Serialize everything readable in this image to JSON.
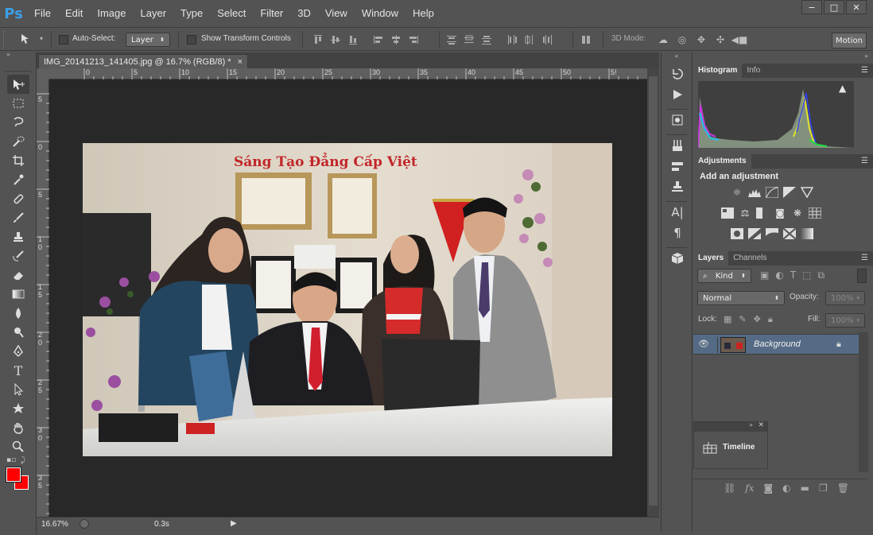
{
  "app": {
    "logo": "Ps",
    "menu": [
      "File",
      "Edit",
      "Image",
      "Layer",
      "Type",
      "Select",
      "Filter",
      "3D",
      "View",
      "Window",
      "Help"
    ],
    "window_controls": [
      "−",
      "□",
      "✕"
    ]
  },
  "options": {
    "auto_select_label": "Auto-Select:",
    "auto_select_value": "Layer",
    "show_transform_label": "Show Transform Controls",
    "mode_3d_label": "3D Mode:",
    "workspace_button": "Motion"
  },
  "document": {
    "tab_title": "IMG_20141213_141405.jpg @ 16.7% (RGB/8) *",
    "tab_close": "×",
    "ruler_h_labels": [
      "0",
      "5",
      "10",
      "15",
      "20",
      "25",
      "30",
      "35",
      "40",
      "45",
      "50",
      "5!"
    ],
    "ruler_v_labels": [
      "5",
      "0",
      "5",
      "1 0",
      "1 5",
      "2 0",
      "2 5",
      "3 0",
      "3 5"
    ],
    "zoom": "16.67%",
    "timing": "0.3s",
    "photo": {
      "banner_text": "Sáng Tạo Đẳng Cấp Việt"
    }
  },
  "colors": {
    "foreground": "#ff0000",
    "background": "#ff0000",
    "accent_layer": "#556b85"
  },
  "panels": {
    "histogram_tabs": [
      "Histogram",
      "Info"
    ],
    "histogram_warning": "▲",
    "adjustments_tab": "Adjustments",
    "adjustments_heading": "Add an adjustment",
    "layers_tabs": [
      "Layers",
      "Channels"
    ],
    "filter_kind": "Kind",
    "blend_mode": "Normal",
    "opacity_label": "Opacity:",
    "opacity_value": "100%",
    "lock_label": "Lock:",
    "fill_label": "Fill:",
    "fill_value": "100%",
    "layer_name": "Background",
    "timeline_label": "Timeline"
  }
}
